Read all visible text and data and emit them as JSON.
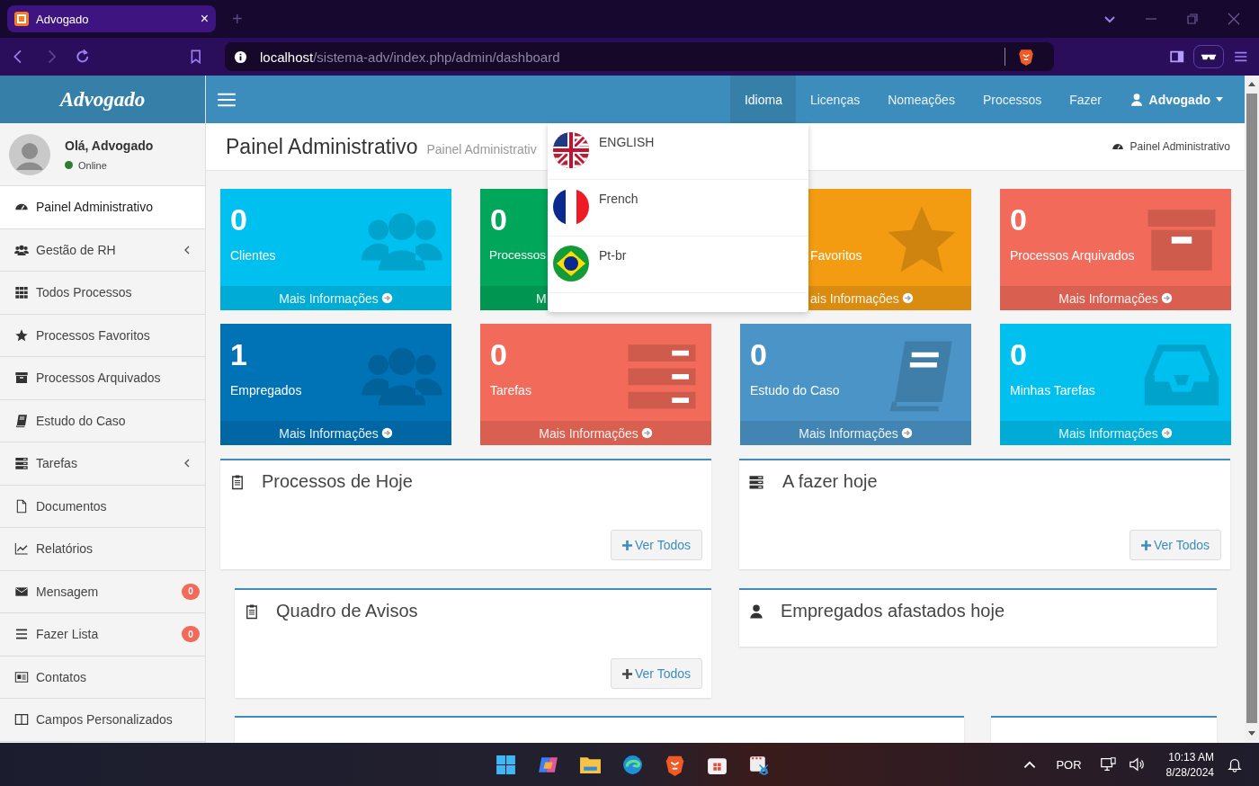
{
  "browser": {
    "tab_title": "Advogado",
    "tab_close": "×",
    "new_tab": "+",
    "url_host": "localhost",
    "url_path": "/sistema-adv/index.php/admin/dashboard"
  },
  "header": {
    "logo": "Advogado",
    "nav": [
      {
        "label": "Idioma",
        "selected": true
      },
      {
        "label": "Licenças",
        "selected": false
      },
      {
        "label": "Nomeações",
        "selected": false
      },
      {
        "label": "Processos",
        "selected": false
      },
      {
        "label": "Fazer",
        "selected": false
      }
    ],
    "user": "Advogado"
  },
  "sidebar": {
    "greeting": "Olá, Advogado",
    "status": "Online",
    "items": [
      {
        "label": "Painel Administrativo",
        "selected": true,
        "expandable": false
      },
      {
        "label": "Gestão de RH",
        "selected": false,
        "expandable": true
      },
      {
        "label": "Todos Processos",
        "selected": false,
        "expandable": false
      },
      {
        "label": "Processos Favoritos",
        "selected": false,
        "expandable": false
      },
      {
        "label": "Processos Arquivados",
        "selected": false,
        "expandable": false
      },
      {
        "label": "Estudo do Caso",
        "selected": false,
        "expandable": false
      },
      {
        "label": "Tarefas",
        "selected": false,
        "expandable": true
      },
      {
        "label": "Documentos",
        "selected": false,
        "expandable": false
      },
      {
        "label": "Relatórios",
        "selected": false,
        "expandable": false
      },
      {
        "label": "Mensagem",
        "selected": false,
        "expandable": false,
        "badge": "0"
      },
      {
        "label": "Fazer Lista",
        "selected": false,
        "expandable": false,
        "badge": "0"
      },
      {
        "label": "Contatos",
        "selected": false,
        "expandable": false
      },
      {
        "label": "Campos Personalizados",
        "selected": false,
        "expandable": false
      }
    ]
  },
  "content_header": {
    "title": "Painel Administrativo",
    "subtitle": "Painel Administrativ",
    "breadcrumb": "Painel Administrativo"
  },
  "tiles": [
    {
      "value": "0",
      "label": "Clientes",
      "footer": "Mais Informações",
      "color": "#00c0ef"
    },
    {
      "value": "0",
      "label": "Processos",
      "footer": "M",
      "color": "#00a65a"
    },
    {
      "label": "Favoritos",
      "footer": "ais Informações",
      "color": "#f39c12"
    },
    {
      "value": "0",
      "label": "Processos Arquivados",
      "footer": "Mais Informações",
      "color": "#f26b5a"
    },
    {
      "value": "1",
      "label": "Empregados",
      "footer": "Mais Informações",
      "color": "#0073b7"
    },
    {
      "value": "0",
      "label": "Tarefas",
      "footer": "Mais Informações",
      "color": "#f26b5a"
    },
    {
      "value": "0",
      "label": "Estudo do Caso",
      "footer": "Mais Informações",
      "color": "#4a94c7"
    },
    {
      "value": "0",
      "label": "Minhas Tarefas",
      "footer": "Mais Informações",
      "color": "#00c0ef"
    }
  ],
  "panels": [
    {
      "title": "Processos de Hoje",
      "button": "Ver Todos"
    },
    {
      "title": "A fazer hoje",
      "button": "Ver Todos"
    },
    {
      "title": "Quadro de Avisos",
      "button": "Ver Todos"
    },
    {
      "title": "Empregados afastados hoje"
    }
  ],
  "language_menu": [
    {
      "label": "ENGLISH"
    },
    {
      "label": "French"
    },
    {
      "label": "Pt-br"
    }
  ],
  "taskbar": {
    "language": "POR",
    "time": "10:13 AM",
    "date": "8/28/2024"
  }
}
